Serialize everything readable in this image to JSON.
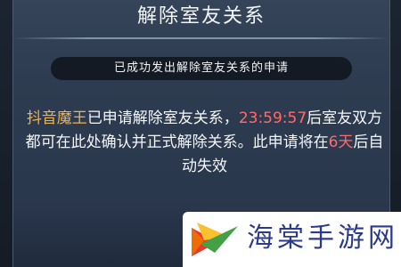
{
  "dialog": {
    "title": "解除室友关系",
    "notice": "已成功发出解除室友关系的申请",
    "message": {
      "player_name": "抖音魔王",
      "part1": "已申请解除室友关系，",
      "countdown": "23:59:57",
      "part2": "后室友双方都可在此处确认并正式解除关系。此申请将在",
      "days": "6天",
      "part3": "后自动失效"
    }
  },
  "watermark": {
    "text": "海棠手游网"
  },
  "colors": {
    "player_name": "#f0b34c",
    "highlight": "#ff6b6b",
    "text": "#f4f6f8"
  }
}
